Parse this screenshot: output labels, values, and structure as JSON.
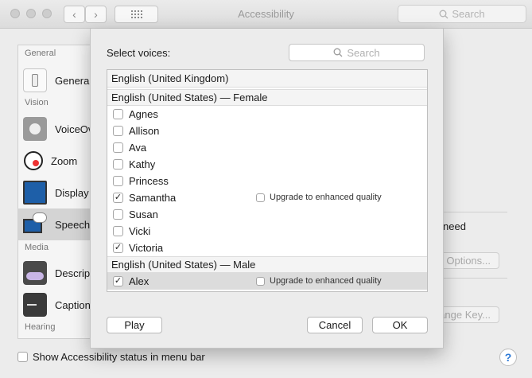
{
  "window": {
    "title": "Accessibility",
    "search_placeholder": "Search"
  },
  "sidebar": {
    "sections": {
      "general": "General",
      "vision": "Vision",
      "media": "Media",
      "hearing": "Hearing"
    },
    "items": [
      {
        "label": "General",
        "icon": "switch-icon"
      },
      {
        "label": "VoiceOver",
        "icon": "voiceover-icon"
      },
      {
        "label": "Zoom",
        "icon": "zoom-icon"
      },
      {
        "label": "Display",
        "icon": "display-icon"
      },
      {
        "label": "Speech",
        "icon": "speech-icon"
      },
      {
        "label": "Descriptions",
        "icon": "descriptions-icon"
      },
      {
        "label": "Captions",
        "icon": "captions-icon"
      }
    ]
  },
  "background": {
    "need_text": "need",
    "options_button": "Options...",
    "change_key_button": "Change Key...",
    "show_status_label": "Show Accessibility status in menu bar",
    "help": "?"
  },
  "sheet": {
    "title": "Select voices:",
    "search_placeholder": "Search",
    "upgrade_label": "Upgrade to enhanced quality",
    "groups": {
      "uk": "English (United Kingdom)",
      "us_female": "English (United States) — Female",
      "us_male": "English (United States) — Male"
    },
    "female_voices": [
      {
        "name": "Agnes",
        "checked": false
      },
      {
        "name": "Allison",
        "checked": false
      },
      {
        "name": "Ava",
        "checked": false
      },
      {
        "name": "Kathy",
        "checked": false
      },
      {
        "name": "Princess",
        "checked": false
      },
      {
        "name": "Samantha",
        "checked": true
      },
      {
        "name": "Susan",
        "checked": false
      },
      {
        "name": "Vicki",
        "checked": false
      },
      {
        "name": "Victoria",
        "checked": true
      }
    ],
    "male_voices": [
      {
        "name": "Alex",
        "checked": true
      }
    ],
    "buttons": {
      "play": "Play",
      "cancel": "Cancel",
      "ok": "OK"
    }
  },
  "icons": {
    "check": "✓"
  }
}
